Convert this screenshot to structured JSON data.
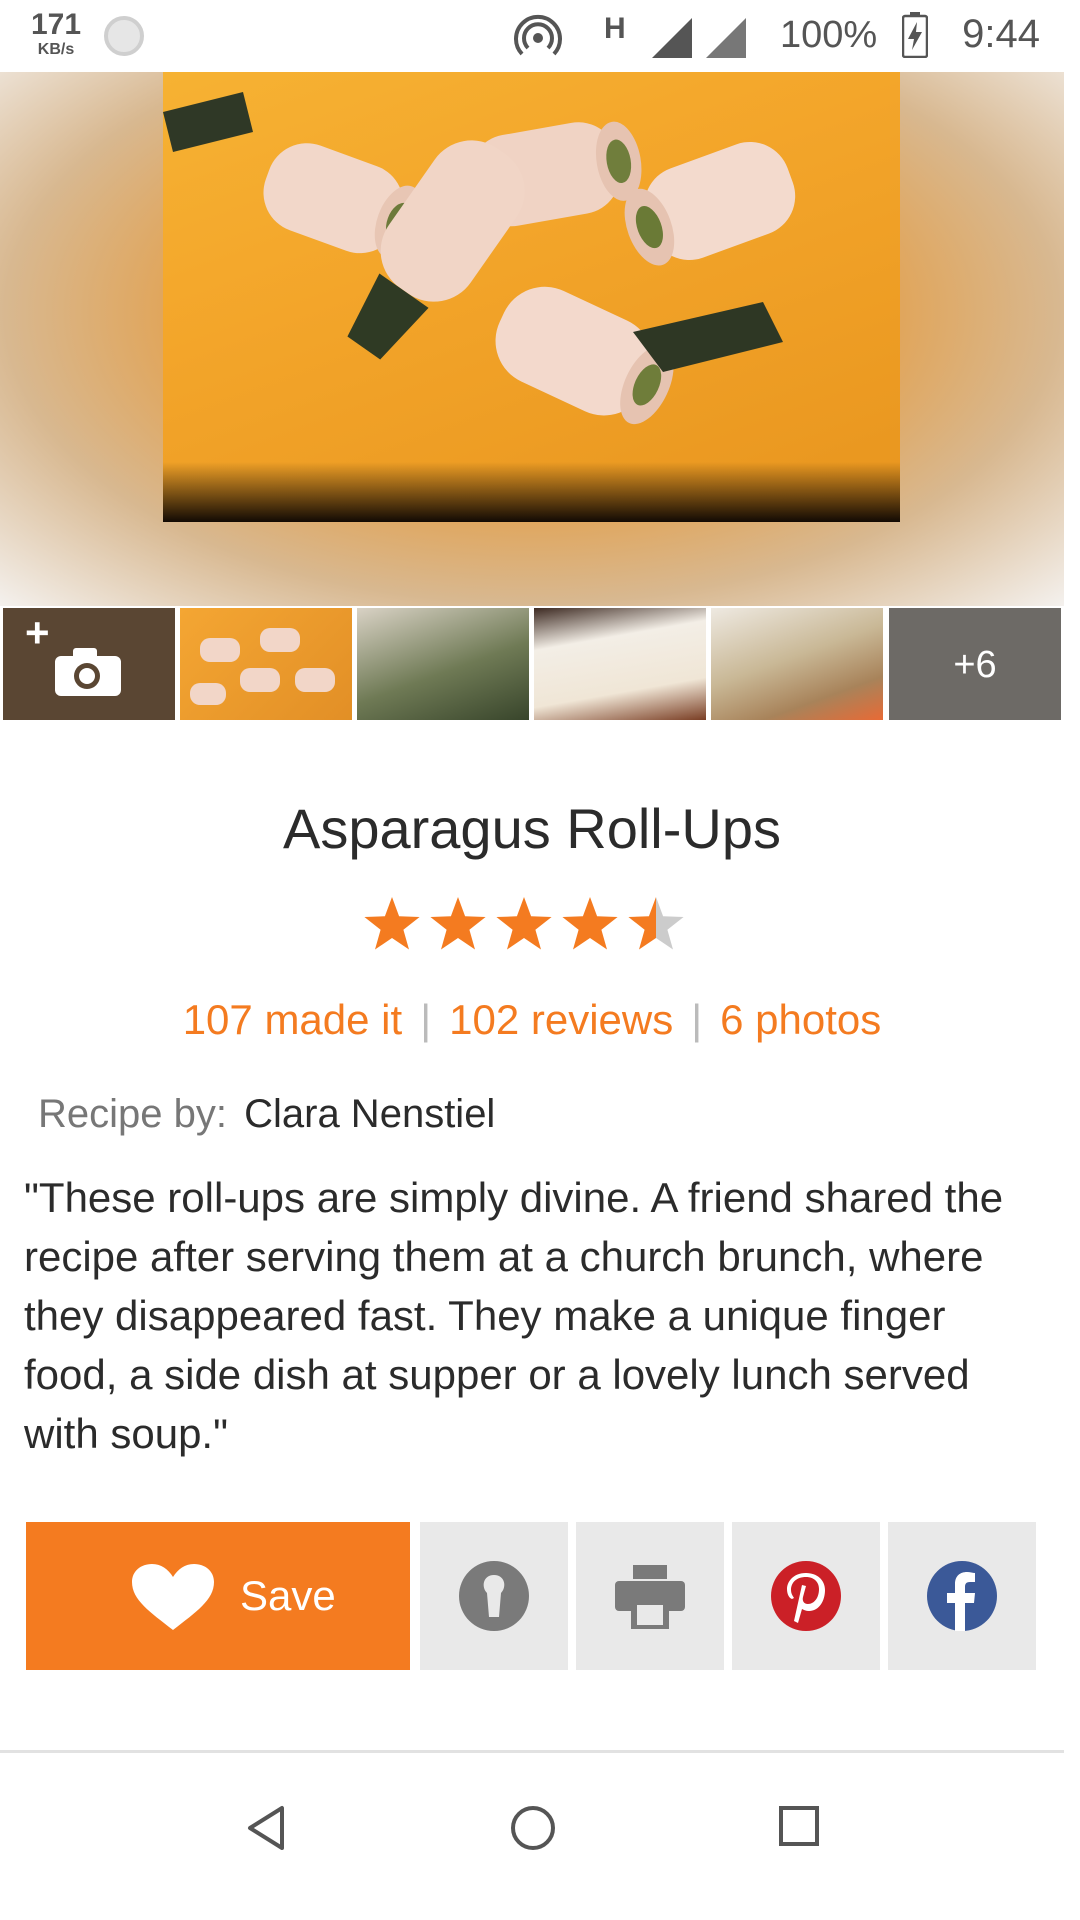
{
  "status_bar": {
    "net_speed_value": "171",
    "net_speed_unit": "KB/s",
    "network_type": "H",
    "battery_percent": "100%",
    "time": "9:44"
  },
  "gallery": {
    "more_count": "+6"
  },
  "recipe": {
    "title": "Asparagus Roll-Ups",
    "rating": 4.5,
    "made_it": "107 made it",
    "reviews": "102 reviews",
    "photos": "6 photos",
    "recipe_by_label": "Recipe by:",
    "author": "Clara Nenstiel",
    "description": "\"These roll-ups are simply divine. A friend shared the recipe after serving them at a church brunch, where they disappeared fast. They make a unique finger food, a side dish at supper or a lovely lunch served with soup.\""
  },
  "actions": {
    "save_label": "Save"
  },
  "colors": {
    "accent": "#f47b20",
    "pinterest": "#cb2027",
    "facebook": "#3b5998",
    "star_empty": "#cccccc"
  }
}
